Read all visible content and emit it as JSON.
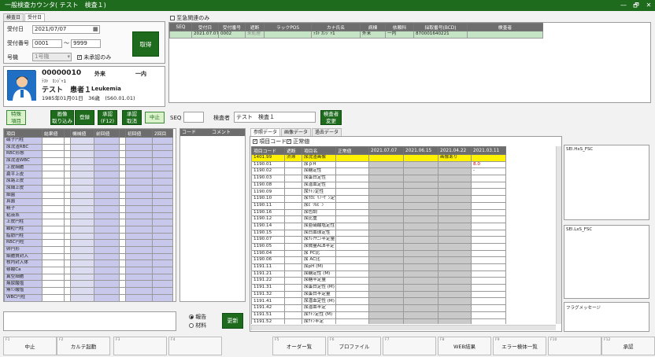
{
  "window": {
    "title": "一般検査カウンタ( テスト　検査１)",
    "min": "—",
    "restore": "🗗",
    "close": "✕"
  },
  "top_tabs": [
    "検査日",
    "受付日"
  ],
  "search": {
    "date_label": "受付日",
    "date_value": "2021/07/07",
    "num_label": "受付番号",
    "num_from": "0001",
    "tilde": "～",
    "num_to": "9999",
    "unit_label": "号機",
    "unit_value": "1号機",
    "unapproved_label": "未承認のみ",
    "get_button": "取得"
  },
  "patient": {
    "id": "00000010",
    "type": "外来",
    "ward": "一内",
    "kana": "ﾃｽﾄ　ｶﾝｼﾞｬ1",
    "name": "テスト　患者１",
    "diagnosis": "Leukemia",
    "dob": "1985年01月01日　36歳　(S60.01.01)"
  },
  "toolbar": {
    "special": "特殊\n項目",
    "image": "画像\n取り込み",
    "register": "登録",
    "approve": "承認\n(F12)",
    "approve_cancel": "承認\n取消",
    "stop": "中止",
    "seq_label": "SEQ",
    "seq_value": "",
    "inspector_label": "検査者",
    "inspector_value": "テスト　検査１",
    "change_inspector": "検査者\n変更"
  },
  "urgent": {
    "label": "至急関連のみ"
  },
  "reception": {
    "headers": [
      "SEQ",
      "受付日",
      "受付番号",
      "遮断",
      "ラックPOS",
      "カナ氏名",
      "病棟",
      "依頼科",
      "採取番号(BCD)",
      "検査者"
    ],
    "rows": [
      [
        "",
        "2021.07.07",
        "0002",
        "未処理",
        "",
        "ﾃｽﾄ ｶﾝｼﾞｬ1",
        "外来",
        "一内",
        "870001640221",
        ""
      ]
    ]
  },
  "left_table": {
    "headers": [
      "項目",
      "結果値",
      "",
      "機械値",
      "前回値",
      "",
      "初回値",
      "2回目"
    ],
    "items": [
      "硝子円柱",
      "尿沈渣RBC",
      "RBC形態",
      "尿沈渣WBC",
      "上皮細胞",
      "扁平上皮",
      "尿路上皮",
      "尿細上皮",
      "細菌",
      "真菌",
      "精子",
      "粘液糸",
      "上皮円柱",
      "顆粒円柱",
      "脂肪円柱",
      "RBC円柱",
      "卵円形",
      "細胞質封入",
      "核内封入体",
      "蓚酸Ca",
      "異型細胞",
      "無尿酸塩",
      "無ﾘﾝ酸塩",
      "WBC円柱"
    ]
  },
  "code_panel": {
    "code": "コード",
    "comment": "コメント"
  },
  "report": {
    "options": [
      "報告",
      "材料"
    ],
    "update": "更新"
  },
  "right_tabs": [
    "参照データ",
    "画像データ",
    "過去データ"
  ],
  "filters": {
    "item_code": "項目コード",
    "normal": "正常値"
  },
  "history": {
    "headers": [
      "項目コード",
      "遮断",
      "項目名",
      "正常値",
      "2021.07.07",
      "2021.06.15",
      "2021.04.22",
      "2021.03.11"
    ],
    "rows": [
      [
        "1401.99",
        "渋滞",
        "尿沈渣画像",
        "",
        "",
        "",
        "画像あり",
        ""
      ],
      [
        "1190.01",
        "",
        "尿ｐH",
        "",
        "",
        "",
        "",
        "8.0"
      ],
      [
        "1190.02",
        "",
        "尿糖定性",
        "",
        "",
        "",
        "",
        "-"
      ],
      [
        "1190.03",
        "",
        "尿蛋白定性",
        "",
        "",
        "",
        "",
        ""
      ],
      [
        "1190.08",
        "",
        "尿潜血定性",
        "",
        "",
        "",
        "",
        ""
      ],
      [
        "1190.09",
        "",
        "尿ｹﾄﾝ定性",
        "",
        "",
        "",
        "",
        ""
      ],
      [
        "1190.10",
        "",
        "尿ｳﾛﾋﾞﾘﾉｰｹﾞﾝ定性",
        "",
        "",
        "",
        "",
        ""
      ],
      [
        "1190.11",
        "",
        "尿ﾋﾞﾘﾙﾋﾞﾝ",
        "",
        "",
        "",
        "",
        ""
      ],
      [
        "1190.16",
        "",
        "尿色調",
        "",
        "",
        "",
        "",
        ""
      ],
      [
        "1190.12",
        "",
        "尿比重",
        "",
        "",
        "",
        "",
        ""
      ],
      [
        "1190.14",
        "",
        "尿亜硝酸塩定性",
        "",
        "",
        "",
        "",
        ""
      ],
      [
        "1190.15",
        "",
        "尿白血球定性",
        "",
        "",
        "",
        "",
        ""
      ],
      [
        "1190.07",
        "",
        "尿ｸﾚｱﾁﾆﾝ半定量",
        "",
        "",
        "",
        "",
        ""
      ],
      [
        "1190.05",
        "",
        "尿微量ALB半定",
        "",
        "",
        "",
        "",
        ""
      ],
      [
        "1190.04",
        "",
        "尿 PC比",
        "",
        "",
        "",
        "",
        ""
      ],
      [
        "1190.06",
        "",
        "尿 AC比",
        "",
        "",
        "",
        "",
        ""
      ],
      [
        "1191.11",
        "",
        "尿pH (M)",
        "",
        "",
        "",
        "",
        ""
      ],
      [
        "1191.21",
        "",
        "尿糖定性 (M)",
        "",
        "",
        "",
        "",
        ""
      ],
      [
        "1191.22",
        "",
        "尿糖半定量",
        "",
        "",
        "",
        "",
        ""
      ],
      [
        "1191.31",
        "",
        "尿蛋白定性 (M)",
        "",
        "",
        "",
        "",
        ""
      ],
      [
        "1191.32",
        "",
        "尿蛋白半定量",
        "",
        "",
        "",
        "",
        ""
      ],
      [
        "1191.41",
        "",
        "尿潜血定性 (M)",
        "",
        "",
        "",
        "",
        ""
      ],
      [
        "1191.42",
        "",
        "尿潜血半定",
        "",
        "",
        "",
        "",
        ""
      ],
      [
        "1191.51",
        "",
        "尿ｹﾄﾝ定性 (M)",
        "",
        "",
        "",
        "",
        ""
      ],
      [
        "1191.52",
        "",
        "尿ｹﾄﾝ半定",
        "",
        "",
        "",
        "",
        ""
      ]
    ]
  },
  "side": {
    "sel_hs": "SEl.HxS_FSC",
    "sel_ls": "SEl.LxS_FSC",
    "flag": "フラグメッセージ"
  },
  "fkeys": [
    {
      "n": "F1",
      "l": "中止"
    },
    {
      "n": "F2",
      "l": "カルテ起動"
    },
    {
      "n": "F3",
      "l": ""
    },
    {
      "n": "F4",
      "l": ""
    },
    {
      "n": "F5",
      "l": "オーダー覧"
    },
    {
      "n": "F6",
      "l": "プロファイル"
    },
    {
      "n": "F7",
      "l": ""
    },
    {
      "n": "F8",
      "l": "WEB結果"
    },
    {
      "n": "F9",
      "l": "エラー検体一覧"
    },
    {
      "n": "F10",
      "l": ""
    },
    {
      "n": "F12",
      "l": "承認"
    }
  ],
  "colors": {
    "green": "#1e6b1e",
    "highlight": "#fff200",
    "selected_row": "#c5e3c5",
    "lavender": "#c8c8ec",
    "red": "#d40000"
  }
}
